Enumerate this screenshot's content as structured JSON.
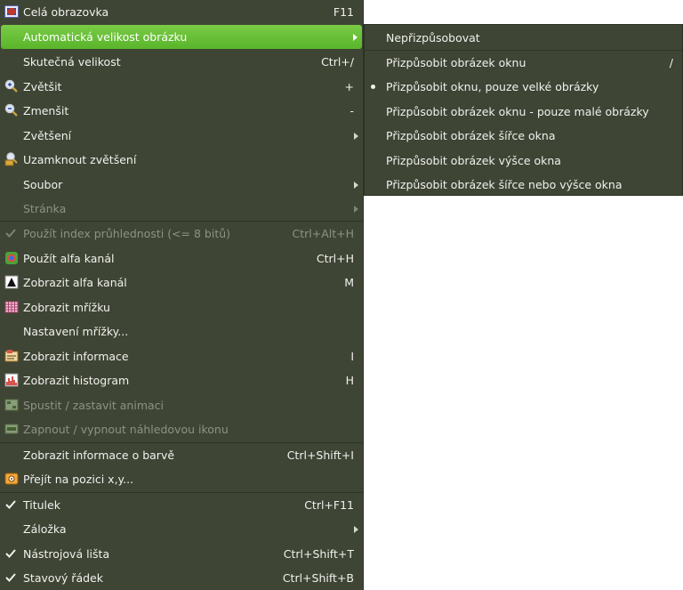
{
  "menu": {
    "items": [
      {
        "label": "Celá obrazovka",
        "shortcut": "F11"
      },
      {
        "label": "Automatická velikost obrázku"
      },
      {
        "label": "Skutečná velikost",
        "shortcut": "Ctrl+/"
      },
      {
        "label": "Zvětšit",
        "shortcut": "+"
      },
      {
        "label": "Zmenšit",
        "shortcut": "-"
      },
      {
        "label": "Zvětšení"
      },
      {
        "label": "Uzamknout zvětšení"
      },
      {
        "label": "Soubor"
      },
      {
        "label": "Stránka"
      },
      {
        "label": "Použít index průhlednosti (<= 8 bitů)",
        "shortcut": "Ctrl+Alt+H"
      },
      {
        "label": "Použít alfa kanál",
        "shortcut": "Ctrl+H"
      },
      {
        "label": "Zobrazit alfa kanál",
        "shortcut": "M"
      },
      {
        "label": "Zobrazit mřížku"
      },
      {
        "label": "Nastavení mřížky..."
      },
      {
        "label": "Zobrazit informace",
        "shortcut": "I"
      },
      {
        "label": "Zobrazit histogram",
        "shortcut": "H"
      },
      {
        "label": "Spustit / zastavit animaci"
      },
      {
        "label": "Zapnout / vypnout náhledovou ikonu"
      },
      {
        "label": "Zobrazit informace o barvě",
        "shortcut": "Ctrl+Shift+I"
      },
      {
        "label": "Přejít na pozici x,y..."
      },
      {
        "label": "Titulek",
        "shortcut": "Ctrl+F11"
      },
      {
        "label": "Záložka"
      },
      {
        "label": "Nástrojová lišta",
        "shortcut": "Ctrl+Shift+T"
      },
      {
        "label": "Stavový řádek",
        "shortcut": "Ctrl+Shift+B"
      }
    ]
  },
  "submenu": {
    "items": [
      {
        "label": "Nepřizpůsobovat"
      },
      {
        "label": "Přizpůsobit obrázek oknu",
        "shortcut": "/"
      },
      {
        "label": "Přizpůsobit oknu, pouze velké obrázky"
      },
      {
        "label": "Přizpůsobit obrázek oknu - pouze malé obrázky"
      },
      {
        "label": "Přizpůsobit obrázek šířce okna"
      },
      {
        "label": "Přizpůsobit obrázek výšce okna"
      },
      {
        "label": "Přizpůsobit obrázek šířce nebo výšce okna"
      }
    ]
  },
  "colors": {
    "menu_bg": "#3e4534",
    "highlight": "#66bf37",
    "disabled_text": "#8c9383"
  }
}
